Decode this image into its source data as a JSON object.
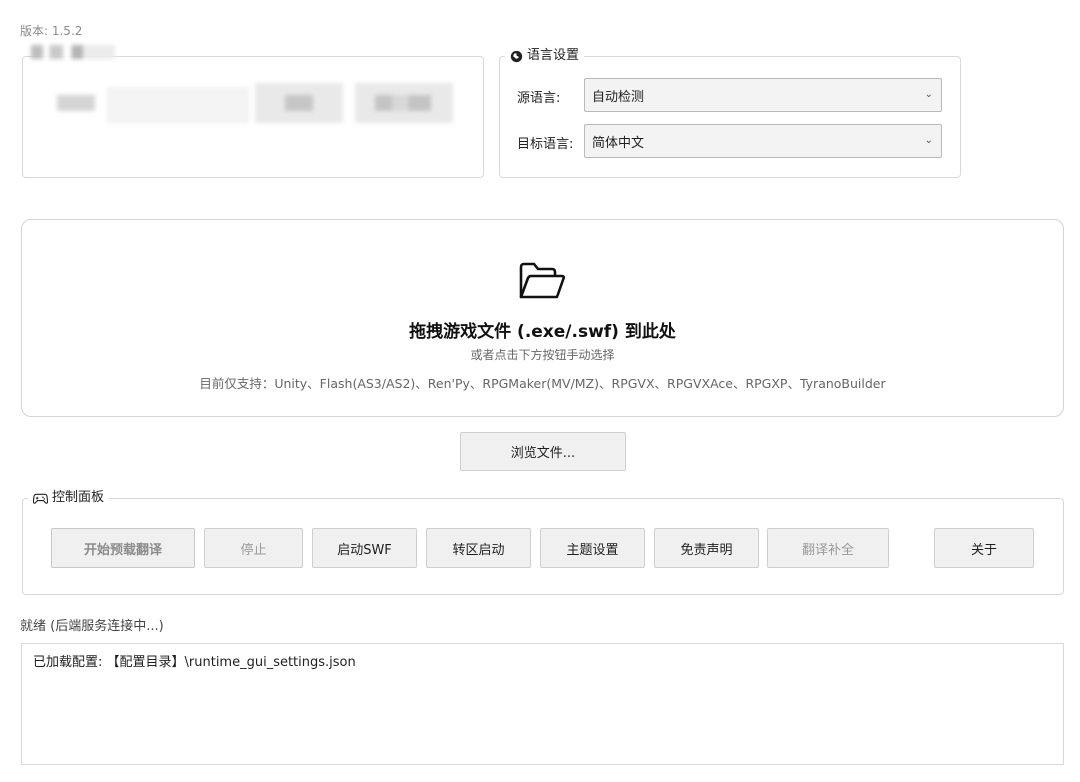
{
  "version_label": "版本: 1.5.2",
  "language_settings": {
    "title": "语言设置",
    "source_label": "源语言:",
    "source_value": "自动检测",
    "target_label": "目标语言:",
    "target_value": "简体中文"
  },
  "dropzone": {
    "title": "拖拽游戏文件 (.exe/.swf) 到此处",
    "subtitle": "或者点击下方按钮手动选择",
    "supported": "目前仅支持：Unity、Flash(AS3/AS2)、Ren'Py、RPGMaker(MV/MZ)、RPGVX、RPGVXAce、RPGXP、TyranoBuilder"
  },
  "browse_button": "浏览文件...",
  "control_panel": {
    "title": "控制面板",
    "buttons": {
      "start": "开始预载翻译",
      "stop": "停止",
      "launch_swf": "启动SWF",
      "locale_launch": "转区启动",
      "theme": "主题设置",
      "disclaimer": "免责声明",
      "complete": "翻译补全",
      "about": "关于"
    }
  },
  "status_text": "就绪 (后端服务连接中...)",
  "log": [
    "已加载配置: 【配置目录】\\runtime_gui_settings.json"
  ],
  "icons": {
    "language": "globe-icon",
    "folder": "folder-open-icon",
    "control": "gamepad-icon"
  }
}
